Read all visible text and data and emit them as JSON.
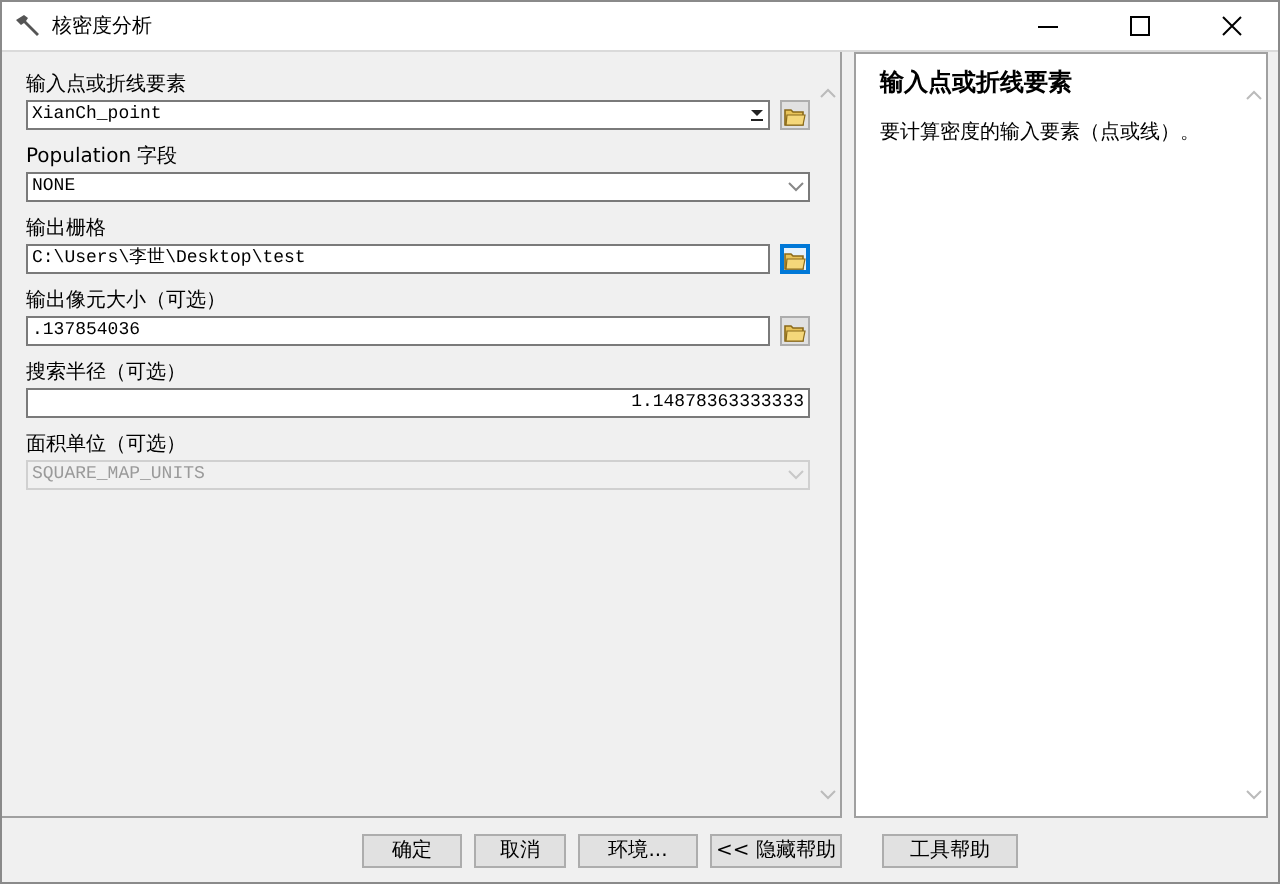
{
  "window": {
    "title": "核密度分析"
  },
  "parameters": [
    {
      "kind": "combo",
      "label": "输入点或折线要素",
      "value": "XianCh_point",
      "focused": false
    },
    {
      "kind": "dropdown",
      "label": "Population 字段",
      "value": "NONE",
      "disabled": false
    },
    {
      "kind": "path",
      "label": "输出栅格",
      "value": "C:\\Users\\李世\\Desktop\\test",
      "focused": true
    },
    {
      "kind": "path",
      "label": "输出像元大小（可选）",
      "value": ".137854036",
      "focused": false
    },
    {
      "kind": "number",
      "label": "搜索半径（可选）",
      "value": "1.14878363333333"
    },
    {
      "kind": "dropdown",
      "label": "面积单位（可选）",
      "value": "SQUARE_MAP_UNITS",
      "disabled": true
    }
  ],
  "help": {
    "title": "输入点或折线要素",
    "text": "要计算密度的输入要素（点或线）。"
  },
  "buttons": [
    {
      "label": "确定"
    },
    {
      "label": "取消"
    },
    {
      "label": "环境..."
    },
    {
      "label": "<< 隐藏帮助"
    },
    {
      "label": "工具帮助"
    }
  ]
}
